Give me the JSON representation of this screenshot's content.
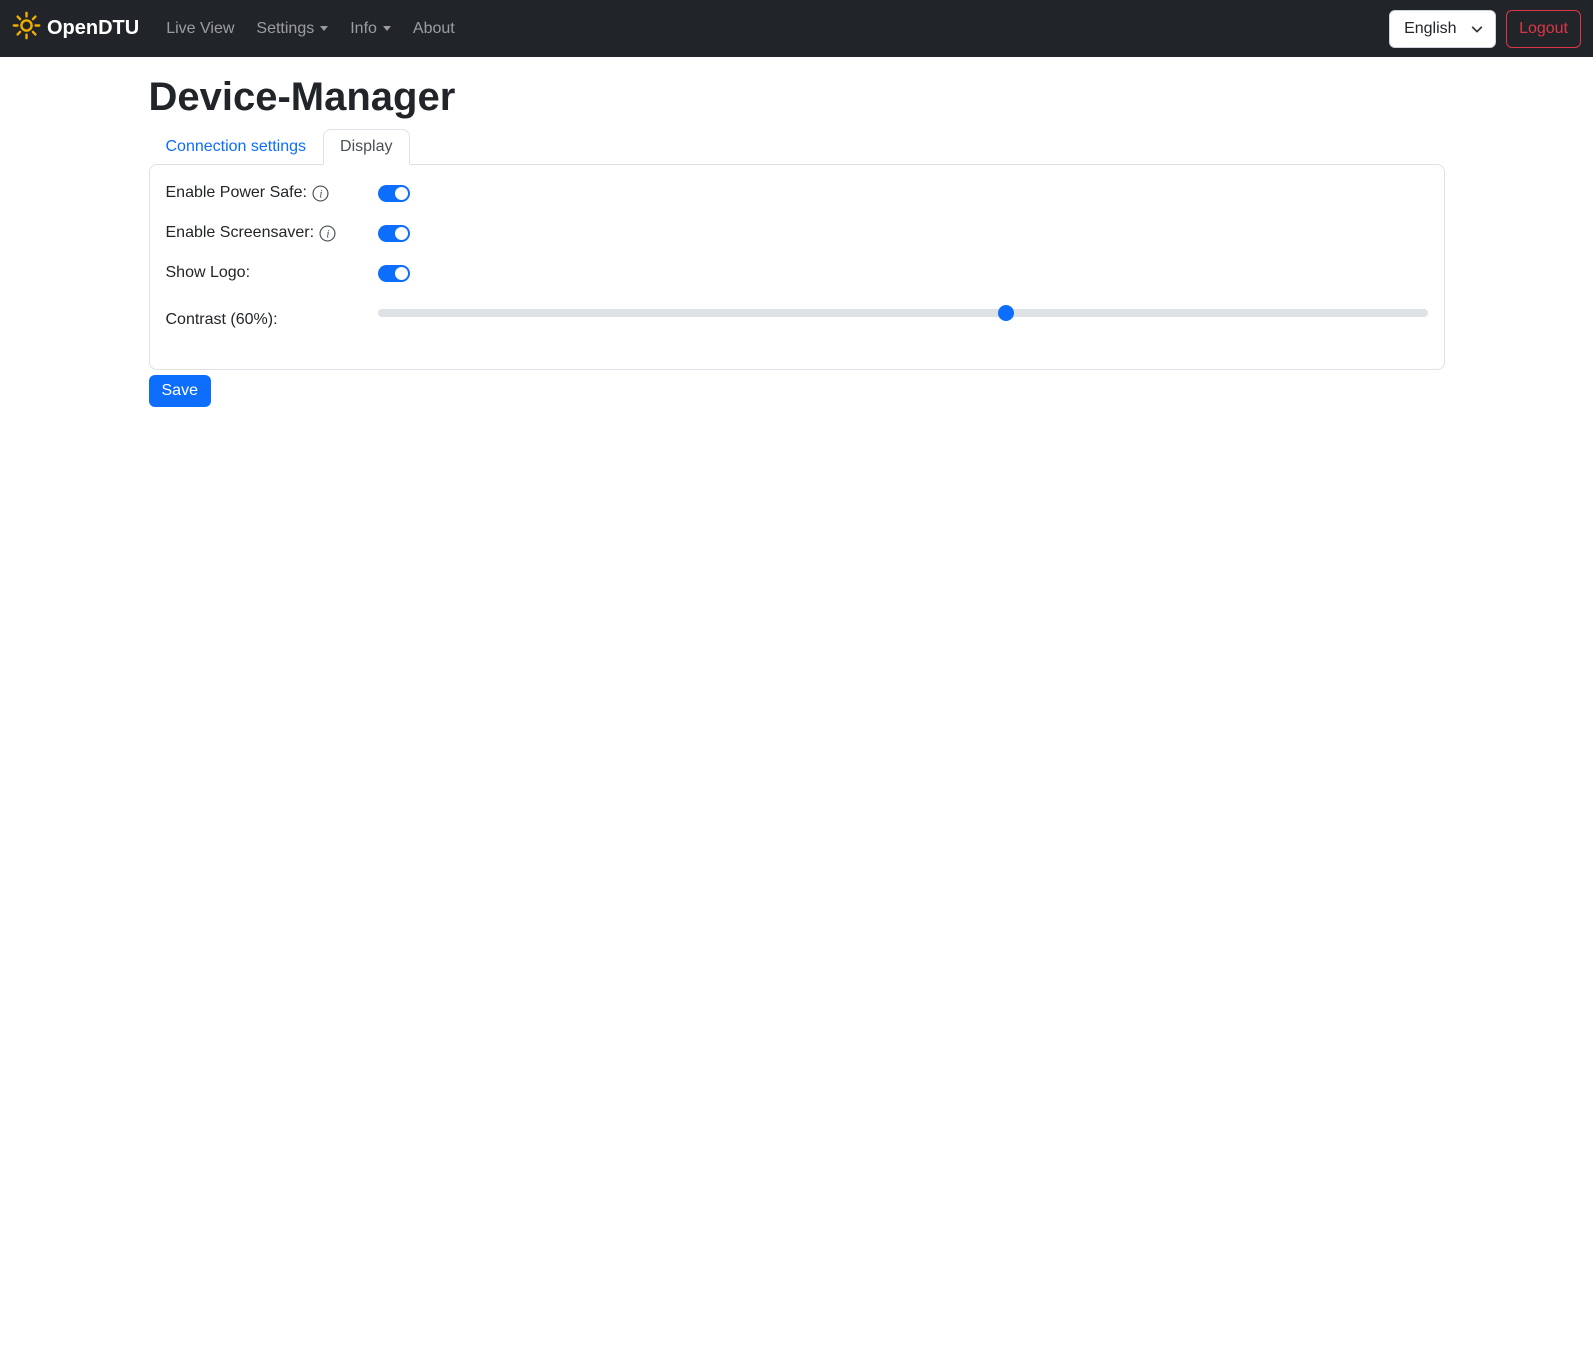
{
  "navbar": {
    "brand": "OpenDTU",
    "items": [
      {
        "label": "Live View",
        "has_caret": false
      },
      {
        "label": "Settings",
        "has_caret": true
      },
      {
        "label": "Info",
        "has_caret": true
      },
      {
        "label": "About",
        "has_caret": false
      }
    ],
    "language": {
      "selected": "English"
    },
    "logout_label": "Logout"
  },
  "page": {
    "title": "Device-Manager"
  },
  "tabs": {
    "connection": {
      "label": "Connection settings",
      "active": false
    },
    "display": {
      "label": "Display",
      "active": true
    }
  },
  "form": {
    "fields": [
      {
        "label": "Enable Power Safe:",
        "type": "toggle",
        "value": true,
        "has_info": true
      },
      {
        "label": "Enable Screensaver:",
        "type": "toggle",
        "value": true,
        "has_info": true
      },
      {
        "label": "Show Logo:",
        "type": "toggle",
        "value": true,
        "has_info": false
      },
      {
        "label": "Contrast (60%):",
        "type": "slider",
        "value": 60,
        "min": 0,
        "max": 100
      }
    ],
    "save_label": "Save"
  },
  "icons": {
    "brand": "sun-icon",
    "nav_dropdown": "caret-down-icon",
    "language": "chevron-down-icon",
    "field_help": "info-icon"
  },
  "colors": {
    "accent_blue": "#0d6efd",
    "navbar_bg": "#212529",
    "nav_link_muted": "rgba(255,255,255,0.55)",
    "logout_red": "#dc3545",
    "brand_icon_yellow": "#f0ad00",
    "card_border": "#dee2e6",
    "active_tab_text": "#495057",
    "slider_track": "#dee2e6"
  }
}
